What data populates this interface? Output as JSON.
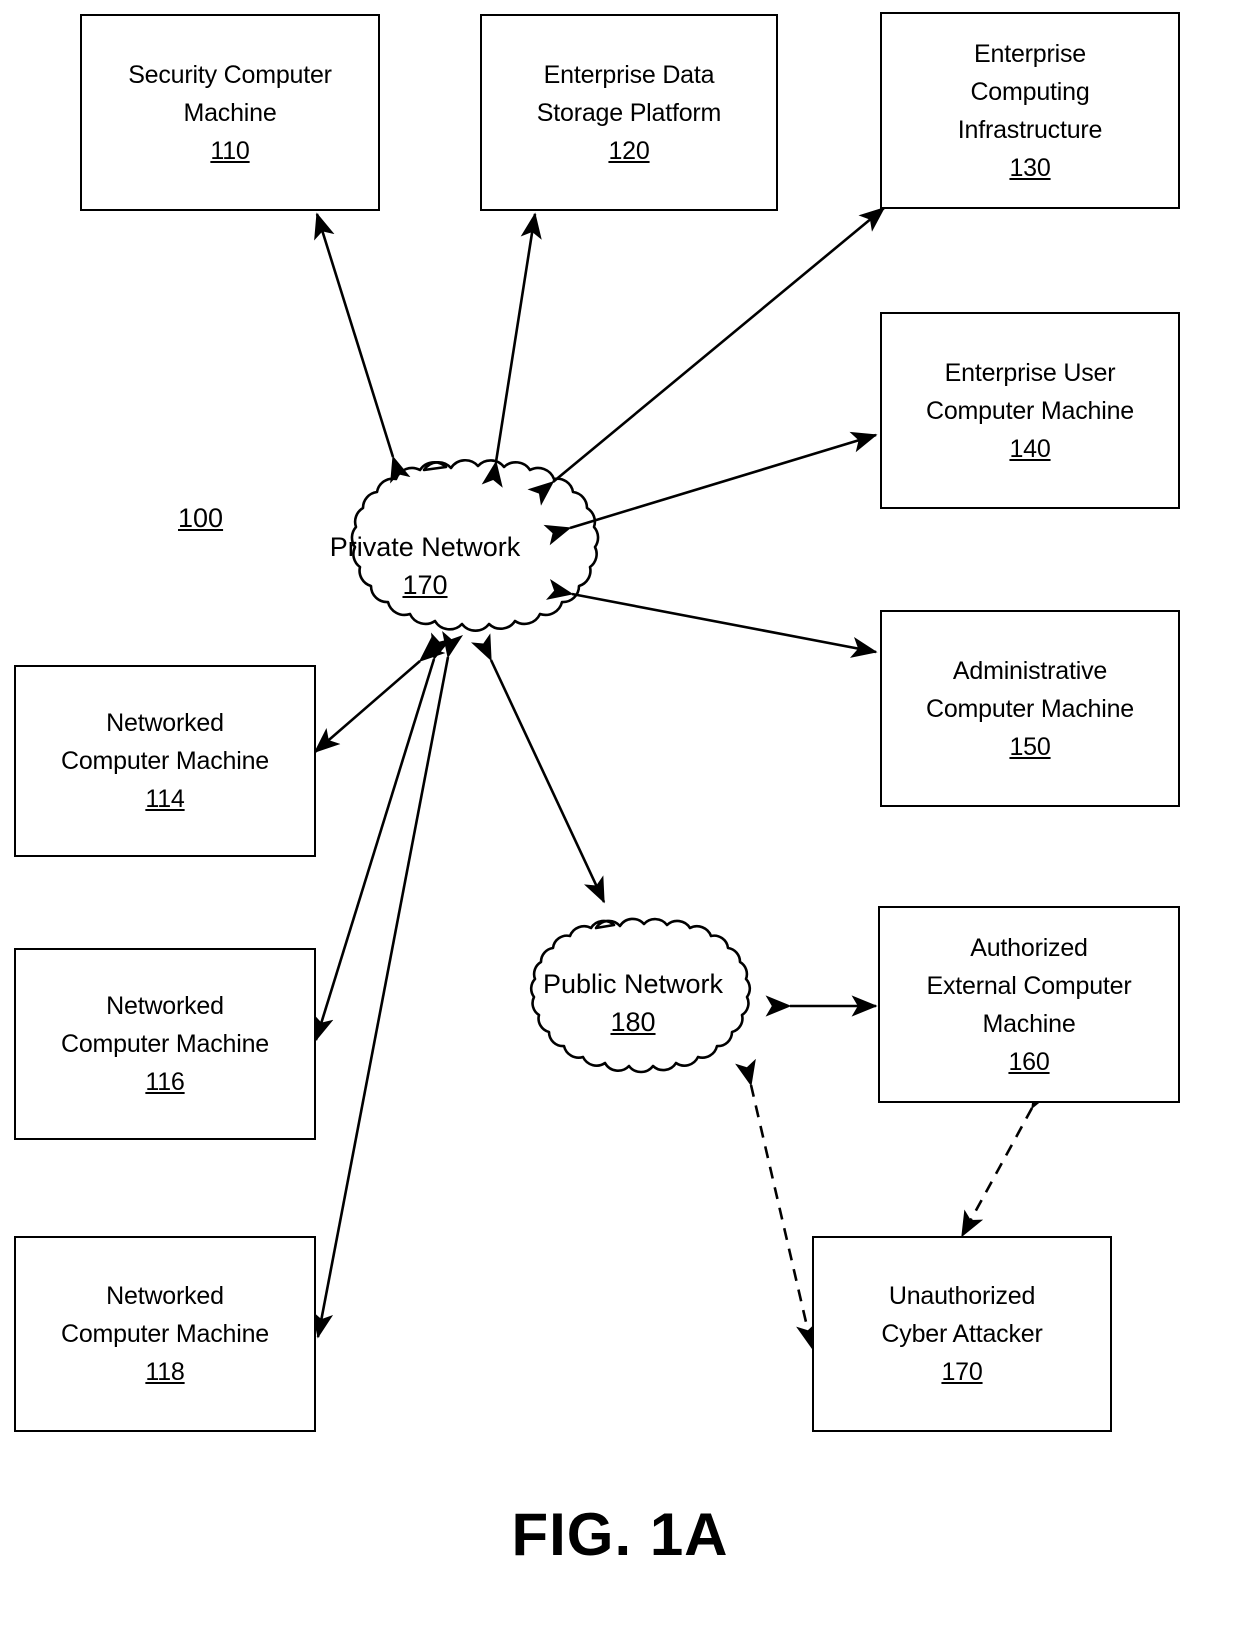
{
  "figure": {
    "caption": "FIG. 1A",
    "diagram_ref": "100"
  },
  "nodes": {
    "security_computer_machine": {
      "line1": "Security Computer",
      "line2": "Machine",
      "ref": "110"
    },
    "enterprise_data_storage_platform": {
      "line1": "Enterprise Data",
      "line2": "Storage Platform",
      "ref": "120"
    },
    "enterprise_computing_infrastructure": {
      "line1": "Enterprise",
      "line2": "Computing",
      "line3": "Infrastructure",
      "ref": "130"
    },
    "enterprise_user_computer_machine": {
      "line1": "Enterprise User",
      "line2": "Computer Machine",
      "ref": "140"
    },
    "administrative_computer_machine": {
      "line1": "Administrative",
      "line2": "Computer Machine",
      "ref": "150"
    },
    "authorized_external_computer_machine": {
      "line1": "Authorized",
      "line2": "External Computer",
      "line3": "Machine",
      "ref": "160"
    },
    "unauthorized_cyber_attacker": {
      "line1": "Unauthorized",
      "line2": "Cyber Attacker",
      "ref": "170"
    },
    "networked_computer_machine_114": {
      "line1": "Networked",
      "line2": "Computer Machine",
      "ref": "114"
    },
    "networked_computer_machine_116": {
      "line1": "Networked",
      "line2": "Computer Machine",
      "ref": "116"
    },
    "networked_computer_machine_118": {
      "line1": "Networked",
      "line2": "Computer Machine",
      "ref": "118"
    },
    "private_network": {
      "line1": "Private Network",
      "ref": "170"
    },
    "public_network": {
      "line1": "Public Network",
      "ref": "180"
    }
  },
  "style": {
    "stroke": "#000000",
    "background": "#ffffff"
  }
}
